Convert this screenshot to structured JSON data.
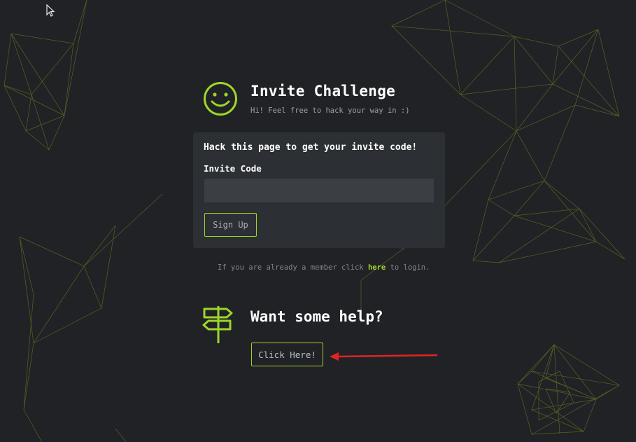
{
  "header": {
    "title": "Invite Challenge",
    "subtitle": "Hi! Feel free to hack your way in :)"
  },
  "form": {
    "heading": "Hack this page to get your invite code!",
    "invite_label": "Invite Code",
    "invite_value": "",
    "signup_label": "Sign Up"
  },
  "login": {
    "prefix": "If you are already a member click ",
    "link_label": "here",
    "suffix": " to login."
  },
  "help": {
    "title": "Want some help?",
    "button_label": "Click Here!"
  },
  "colors": {
    "background": "#202226",
    "card": "#2c2f33",
    "accent": "#9fd52a",
    "annotation_arrow": "#e02424"
  },
  "icons": {
    "header": "smiley-icon",
    "help": "signpost-icon",
    "pointer": "mouse-cursor-icon"
  }
}
